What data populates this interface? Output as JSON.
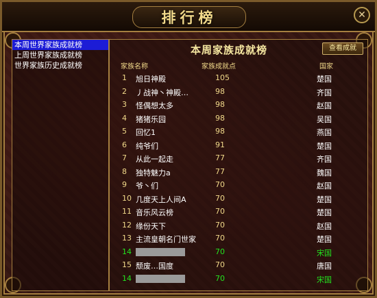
{
  "window": {
    "title": "排行榜",
    "close_icon": "close-icon"
  },
  "left_nav": {
    "items": [
      {
        "label": "本周世界家族成就榜",
        "active": true
      },
      {
        "label": "上周世界家族成就榜",
        "active": false
      },
      {
        "label": "世界家族历史成就榜",
        "active": false
      }
    ]
  },
  "panel": {
    "title": "本周家族成就榜",
    "view_button": "查看成就",
    "headers": {
      "name": "家族名称",
      "points": "家族成就点",
      "country": "国家"
    }
  },
  "rows": [
    {
      "rank": "1",
      "name": "旭日神殿",
      "points": "105",
      "country": "楚国",
      "highlight": false
    },
    {
      "rank": "2",
      "name": "丿战神丶神殿…",
      "points": "98",
      "country": "齐国",
      "highlight": false
    },
    {
      "rank": "3",
      "name": "怪偶想太多",
      "points": "98",
      "country": "赵国",
      "highlight": false
    },
    {
      "rank": "4",
      "name": "猪猪乐园",
      "points": "98",
      "country": "吴国",
      "highlight": false
    },
    {
      "rank": "5",
      "name": "回忆1",
      "points": "98",
      "country": "燕国",
      "highlight": false
    },
    {
      "rank": "6",
      "name": "纯爷们",
      "points": "91",
      "country": "楚国",
      "highlight": false
    },
    {
      "rank": "7",
      "name": "从此一起走",
      "points": "77",
      "country": "齐国",
      "highlight": false
    },
    {
      "rank": "8",
      "name": "独特魅力a",
      "points": "77",
      "country": "魏国",
      "highlight": false
    },
    {
      "rank": "9",
      "name": "爷丶们",
      "points": "70",
      "country": "赵国",
      "highlight": false
    },
    {
      "rank": "10",
      "name": "几度天上人间A",
      "points": "70",
      "country": "楚国",
      "highlight": false
    },
    {
      "rank": "11",
      "name": "音乐风云榜",
      "points": "70",
      "country": "楚国",
      "highlight": false
    },
    {
      "rank": "12",
      "name": "缘份天下",
      "points": "70",
      "country": "赵国",
      "highlight": false
    },
    {
      "rank": "13",
      "name": "主流皇朝名门世家",
      "points": "70",
      "country": "楚国",
      "highlight": false
    },
    {
      "rank": "14",
      "name": "",
      "points": "70",
      "country": "宋国",
      "highlight": true,
      "redacted": true
    },
    {
      "rank": "15",
      "name": "颓废…国度",
      "points": "70",
      "country": "唐国",
      "highlight": false
    },
    {
      "rank": "14",
      "name": "",
      "points": "70",
      "country": "宋国",
      "highlight": true,
      "redacted": true
    }
  ],
  "colors": {
    "gold": "#f1d98a",
    "green": "#23e41f",
    "nav_active": "#1c1cd6"
  }
}
